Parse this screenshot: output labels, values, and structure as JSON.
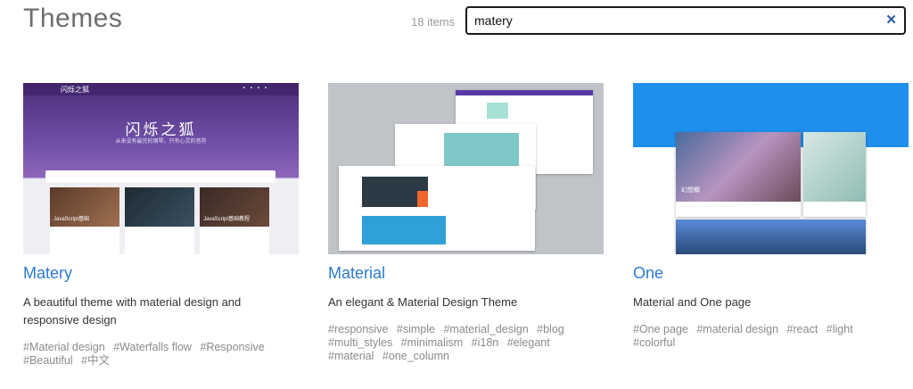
{
  "header": {
    "title": "Themes",
    "count": "18 items"
  },
  "search": {
    "value": "matery",
    "clear_icon": "close-icon"
  },
  "colors": {
    "title_link": "#2b7bd0",
    "tag_text": "#8a8a8a",
    "clear_icon": "#2a5a98"
  },
  "themes": [
    {
      "name": "Matery",
      "description": "A beautiful theme with material design and responsive design",
      "tags": [
        "#Material design",
        "#Waterfalls flow",
        "#Responsive",
        "#Beautiful",
        "#中文"
      ],
      "preview": {
        "logo": "闪烁之狐",
        "hero": "闪烁之狐",
        "subtitle": "从来没有最完的钢琴，只有心灵的音符",
        "post_captions": [
          "JavaScript基础",
          "JavaScript基础教程"
        ]
      }
    },
    {
      "name": "Material",
      "description": "An elegant & Material Design Theme",
      "tags": [
        "#responsive",
        "#simple",
        "#material_design",
        "#blog",
        "#multi_styles",
        "#minimalism",
        "#i18n",
        "#elegant",
        "#material",
        "#one_column"
      ]
    },
    {
      "name": "One",
      "description": "Material and One page",
      "tags": [
        "#One page",
        "#material design",
        "#react",
        "#light",
        "#colorful"
      ],
      "preview": {
        "card_label": "幻想郷"
      }
    }
  ]
}
